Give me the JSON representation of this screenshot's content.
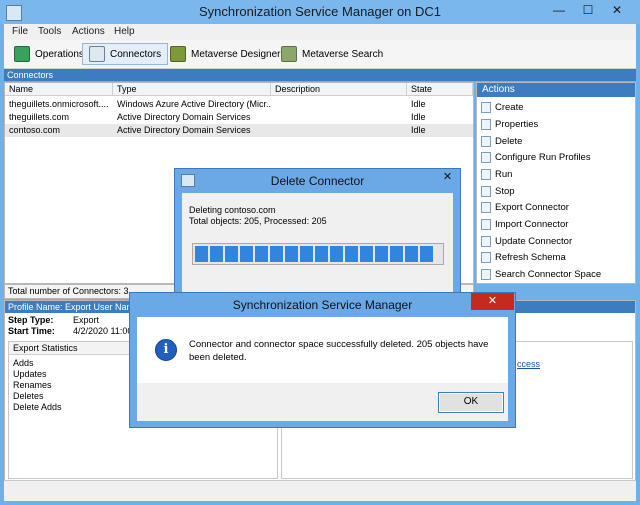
{
  "window": {
    "title": "Synchronization Service Manager on DC1",
    "minimize": "—",
    "maximize": "☐",
    "close": "✕"
  },
  "menu": [
    "File",
    "Tools",
    "Actions",
    "Help"
  ],
  "toolbar": {
    "operations": "Operations",
    "connectors": "Connectors",
    "metaverse_designer": "Metaverse Designer",
    "metaverse_search": "Metaverse Search"
  },
  "connectors_section": "Connectors",
  "table": {
    "columns": [
      "Name",
      "Type",
      "Description",
      "State"
    ],
    "rows": [
      {
        "name": "theguillets.onmicrosoft....",
        "type": "Windows Azure Active Directory (Micr...",
        "description": "",
        "state": "Idle"
      },
      {
        "name": "theguillets.com",
        "type": "Active Directory Domain Services",
        "description": "",
        "state": "Idle"
      },
      {
        "name": "contoso.com",
        "type": "Active Directory Domain Services",
        "description": "",
        "state": "Idle"
      }
    ]
  },
  "actions": {
    "header": "Actions",
    "items": [
      "Create",
      "Properties",
      "Delete",
      "Configure Run Profiles",
      "Run",
      "Stop",
      "Export Connector",
      "Import Connector",
      "Update Connector",
      "Refresh Schema",
      "Search Connector Space"
    ]
  },
  "total_connectors": "Total number of Connectors: 3",
  "profile": {
    "header": "Profile Name: Export  User Name",
    "step_type_label": "Step Type:",
    "step_type_value": "Export",
    "start_time_label": "Start Time:",
    "start_time_value": "4/2/2020 11:00",
    "stats_header": "Export Statistics",
    "stats": [
      "Adds",
      "Updates",
      "Renames",
      "Deletes",
      "Delete Adds"
    ],
    "link_fragment": "ccess"
  },
  "delete_dialog": {
    "title": "Delete Connector",
    "line1": "Deleting contoso.com",
    "line2": "Total objects: 205, Processed: 205",
    "progress_fraction": 1.0
  },
  "message_dialog": {
    "title": "Synchronization Service Manager",
    "message": "Connector and connector space successfully deleted. 205 objects have been deleted.",
    "ok": "OK"
  },
  "colors": {
    "title_bar": "#7ab7ec",
    "section_header": "#3e7cc0",
    "progress": "#2f86dc",
    "close_button": "#c42b1c"
  }
}
